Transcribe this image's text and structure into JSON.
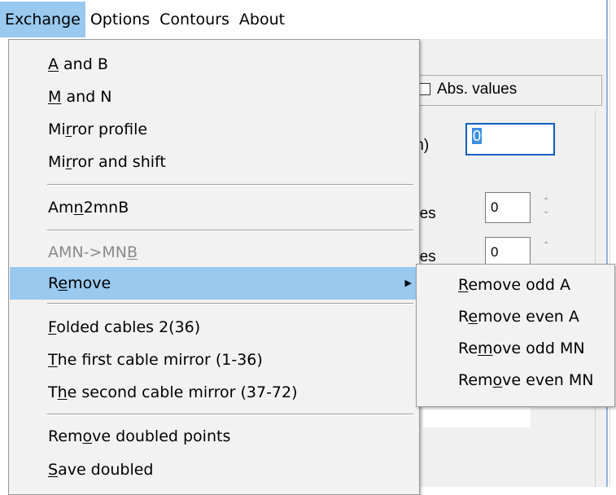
{
  "menubar": {
    "items": [
      "Exchange",
      "Options",
      "Contours",
      "About"
    ]
  },
  "background": {
    "abs_values_label": "Abs. values",
    "field_value": "0",
    "frag_m": "m)",
    "frag_e": "e",
    "frag_nes1": "nes",
    "frag_nes2": "nes",
    "spin1_value": "0",
    "spin2_value": "0"
  },
  "menu": {
    "items": [
      {
        "pre": "",
        "u": "A",
        "post": " and B"
      },
      {
        "pre": "",
        "u": "M",
        "post": " and N"
      },
      {
        "pre": "Mi",
        "u": "r",
        "post": "ror profile"
      },
      {
        "pre": "Mi",
        "u": "r",
        "post": "ror and shift"
      },
      {
        "pre": "Am",
        "u": "n",
        "post": "2mnB"
      },
      {
        "pre": "AMN->MN",
        "u": "B",
        "post": ""
      },
      {
        "pre": "R",
        "u": "e",
        "post": "move"
      },
      {
        "pre": "",
        "u": "F",
        "post": "olded cables 2(36)"
      },
      {
        "pre": "",
        "u": "T",
        "post": "he first cable mirror (1-36)"
      },
      {
        "pre": "T",
        "u": "h",
        "post": "e second cable mirror (37-72)"
      },
      {
        "pre": "Rem",
        "u": "o",
        "post": "ve doubled points"
      },
      {
        "pre": "",
        "u": "S",
        "post": "ave doubled"
      }
    ]
  },
  "submenu": {
    "items": [
      {
        "pre": "",
        "u": "R",
        "post": "emove odd A"
      },
      {
        "pre": "R",
        "u": "e",
        "post": "move even A"
      },
      {
        "pre": "Re",
        "u": "m",
        "post": "ove odd MN"
      },
      {
        "pre": "Rem",
        "u": "o",
        "post": "ve even MN"
      }
    ]
  }
}
